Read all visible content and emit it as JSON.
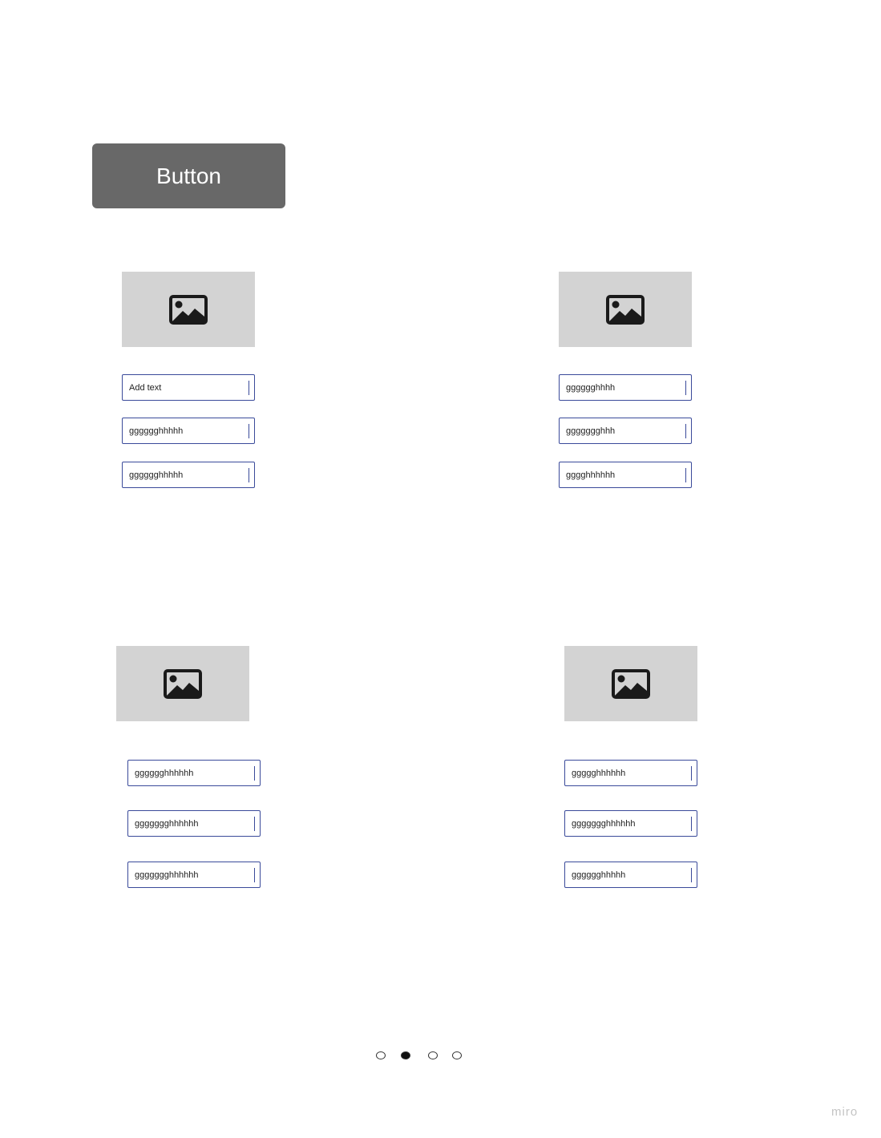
{
  "button": {
    "label": "Button"
  },
  "cards": [
    {
      "image_icon": "image-icon",
      "fields": [
        "Add text",
        "gggggghhhhh",
        "gggggghhhhh"
      ]
    },
    {
      "image_icon": "image-icon",
      "fields": [
        "gggggghhhh",
        "ggggggghhh",
        "gggghhhhhh"
      ]
    },
    {
      "image_icon": "image-icon",
      "fields": [
        "gggggghhhhhh",
        "ggggggghhhhhh",
        "ggggggghhhhhh"
      ]
    },
    {
      "image_icon": "image-icon",
      "fields": [
        "ggggghhhhhh",
        "ggggggghhhhhh",
        "gggggghhhhh"
      ]
    }
  ],
  "pagination": {
    "pages": 4,
    "active_index": 1
  },
  "watermark": "miro",
  "colors": {
    "button_bg": "#686868",
    "placeholder_bg": "#d3d3d3",
    "field_border": "#3a4a9a",
    "dot_active": "#111111"
  }
}
